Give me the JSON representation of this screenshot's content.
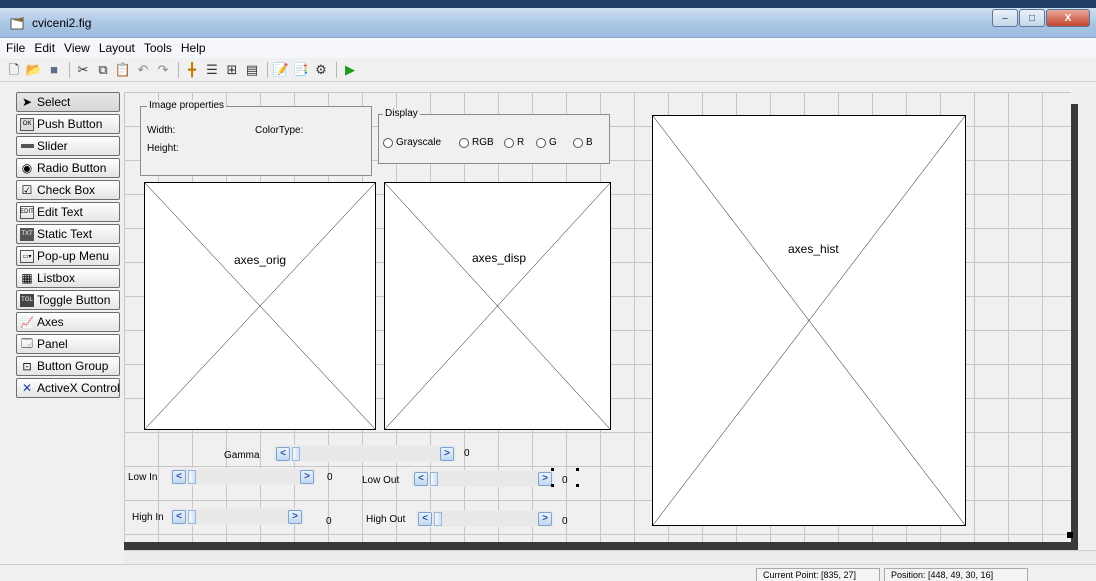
{
  "window": {
    "title": "cviceni2.fig",
    "buttons": {
      "minimize": "–",
      "maximize": "□",
      "close": "X"
    }
  },
  "menu": [
    "File",
    "Edit",
    "View",
    "Layout",
    "Tools",
    "Help"
  ],
  "toolbar": {
    "icons": [
      "new-file-icon",
      "open-folder-icon",
      "save-icon",
      "cut-icon",
      "copy-icon",
      "paste-icon",
      "undo-icon",
      "redo-icon",
      "align-objects-icon",
      "menu-editor-icon",
      "tab-order-icon",
      "toolbar-editor-icon",
      "m-file-editor-icon",
      "property-inspector-icon",
      "object-browser-icon",
      "run-icon"
    ]
  },
  "palette": [
    {
      "label": "Select",
      "icon": "pointer-icon"
    },
    {
      "label": "Push Button",
      "icon": "push-button-icon"
    },
    {
      "label": "Slider",
      "icon": "slider-icon"
    },
    {
      "label": "Radio Button",
      "icon": "radio-button-icon"
    },
    {
      "label": "Check Box",
      "icon": "check-box-icon"
    },
    {
      "label": "Edit Text",
      "icon": "edit-text-icon"
    },
    {
      "label": "Static Text",
      "icon": "static-text-icon"
    },
    {
      "label": "Pop-up Menu",
      "icon": "popup-menu-icon"
    },
    {
      "label": "Listbox",
      "icon": "listbox-icon"
    },
    {
      "label": "Toggle Button",
      "icon": "toggle-button-icon"
    },
    {
      "label": "Axes",
      "icon": "axes-icon"
    },
    {
      "label": "Panel",
      "icon": "panel-icon"
    },
    {
      "label": "Button Group",
      "icon": "button-group-icon"
    },
    {
      "label": "ActiveX Control",
      "icon": "activex-icon"
    }
  ],
  "image_properties": {
    "title": "Image properties",
    "width_label": "Width:",
    "colortype_label": "ColorType:",
    "height_label": "Height:"
  },
  "display": {
    "title": "Display",
    "options": [
      "Grayscale",
      "RGB",
      "R",
      "G",
      "B"
    ]
  },
  "axes": {
    "orig": "axes_orig",
    "disp": "axes_disp",
    "hist": "axes_hist"
  },
  "controls": {
    "gamma_label": "Gamma",
    "gamma_value": "0",
    "low_in_label": "Low In",
    "low_in_value": "0",
    "low_out_label": "Low Out",
    "low_out_value": "0",
    "high_in_label": "High In",
    "high_in_value": "0",
    "high_out_label": "High Out",
    "high_out_value": "0"
  },
  "status": {
    "current_point": "Current Point:  [835, 27]",
    "position": "Position:  [448, 49, 30, 16]"
  },
  "colors": {
    "title_bar": "#a9c5e3",
    "canvas_grid": "#c6c6c6",
    "slider_arrow": "#2a56a0",
    "run_icon": "#1e9a1e"
  }
}
